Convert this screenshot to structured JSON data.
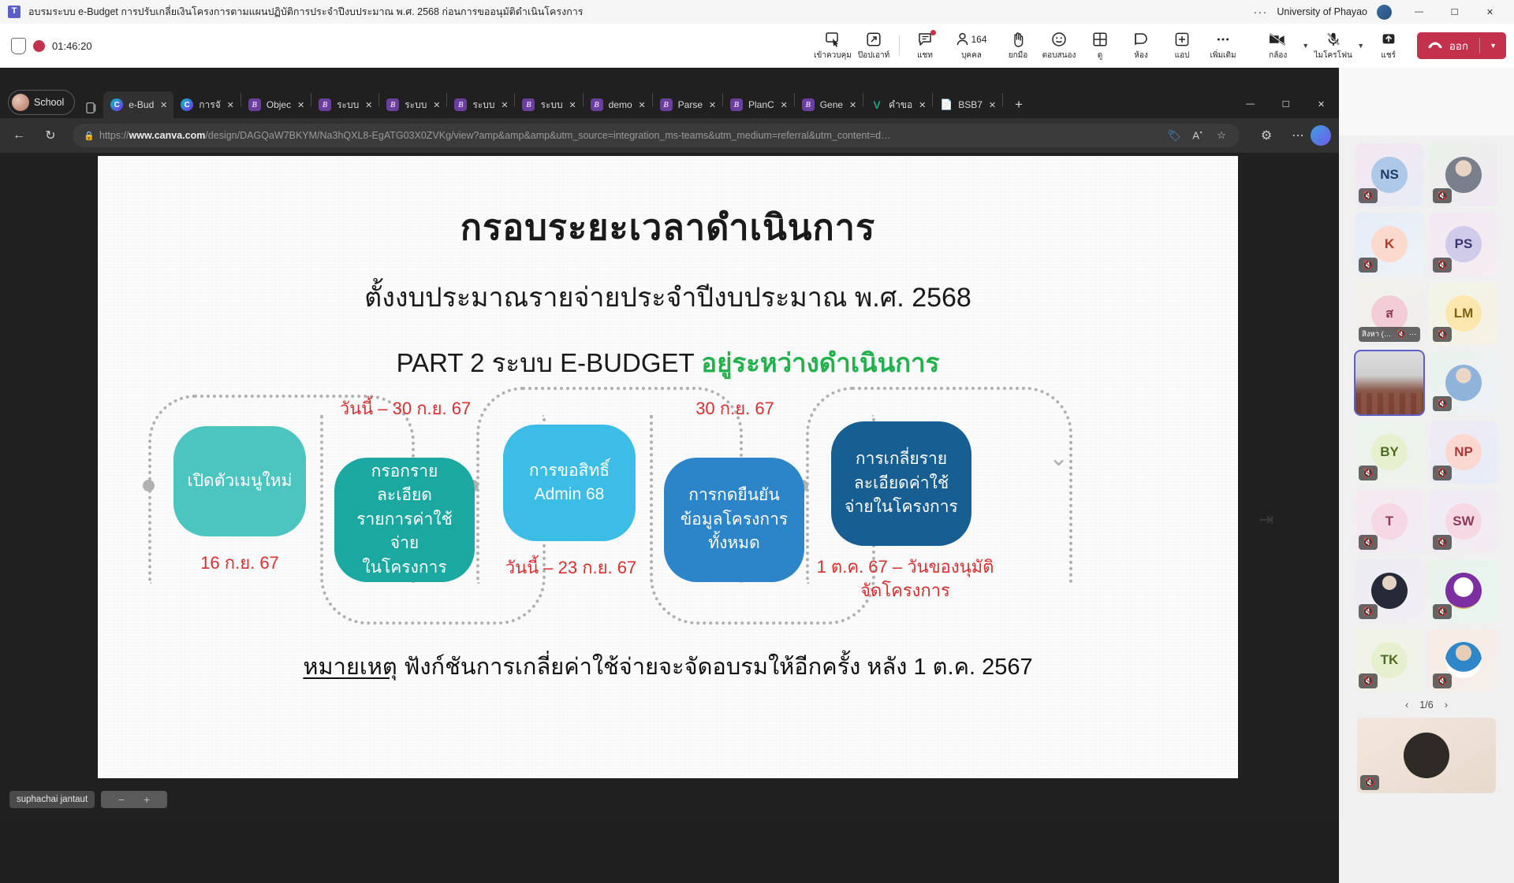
{
  "titlebar": {
    "meeting_title": "อบรมระบบ e-Budget การปรับเกลี่ยเงินโครงการตามแผนปฏิบัติการประจำปีงบประมาณ พ.ศ. 2568 ก่อนการขออนุมัติดำเนินโครงการ",
    "overflow": "···",
    "org": "University of Phayao",
    "minimize": "—",
    "maximize": "☐",
    "close": "✕"
  },
  "meetingbar": {
    "timer": "01:46:20",
    "items": [
      {
        "icon": "take-control-icon",
        "label": "เข้าควบคุม"
      },
      {
        "icon": "pop-out-icon",
        "label": "ป๊อปเอาท์"
      },
      {
        "icon": "chat-icon",
        "label": "แชท",
        "badge": true
      },
      {
        "icon": "people-icon",
        "label": "บุคคล",
        "count": "164"
      },
      {
        "icon": "raise-hand-icon",
        "label": "ยกมือ"
      },
      {
        "icon": "react-icon",
        "label": "ตอบสนอง"
      },
      {
        "icon": "view-icon",
        "label": "ดู"
      },
      {
        "icon": "rooms-icon",
        "label": "ห้อง"
      },
      {
        "icon": "apps-icon",
        "label": "แอป"
      },
      {
        "icon": "more-icon",
        "label": "เพิ่มเติม"
      }
    ],
    "camera": {
      "label": "กล้อง",
      "state": "off"
    },
    "microphone": {
      "label": "ไมโครโฟน",
      "state": "off"
    },
    "share": {
      "label": "แชร์"
    },
    "leave": {
      "label": "ออก"
    }
  },
  "browser": {
    "profile": "School",
    "tabs": [
      {
        "title": "e-Bud",
        "favicon": "canva",
        "active": true
      },
      {
        "title": "การจั",
        "favicon": "canva",
        "active": false
      },
      {
        "title": "Objec",
        "favicon": "purple",
        "active": false
      },
      {
        "title": "ระบบ",
        "favicon": "purple",
        "active": false
      },
      {
        "title": "ระบบ",
        "favicon": "purple",
        "active": false
      },
      {
        "title": "ระบบ",
        "favicon": "purple",
        "active": false
      },
      {
        "title": "ระบบ",
        "favicon": "purple",
        "active": false
      },
      {
        "title": "demo",
        "favicon": "purple",
        "active": false
      },
      {
        "title": "Parse",
        "favicon": "purple",
        "active": false
      },
      {
        "title": "PlanC",
        "favicon": "purple",
        "active": false
      },
      {
        "title": "Gene",
        "favicon": "purple",
        "active": false
      },
      {
        "title": "คำขอ",
        "favicon": "v",
        "active": false
      },
      {
        "title": "BSB7",
        "favicon": "doc",
        "active": false
      }
    ],
    "new_tab": "+",
    "back": "←",
    "reload": "↻",
    "lock_icon": "lock-icon",
    "url_prefix": "https://",
    "url_domain": "www.canva.com",
    "url_rest": "/design/DAGQaW7BKYM/Na3hQXL8-EgATG03X0ZVKg/view?amp&amp&amp&utm_source=integration_ms-teams&utm_medium=referral&utm_content=d…",
    "icons": [
      "tag-icon",
      "read-aloud-icon",
      "favorite-icon",
      "settings-icon",
      "more-icon",
      "copilot-icon"
    ],
    "window_minimize": "—",
    "window_maximize": "☐",
    "window_close": "✕"
  },
  "slide": {
    "title": "กรอบระยะเวลาดำเนินการ",
    "subtitle": "ตั้งงบประมาณรายจ่ายประจำปีงบประมาณ พ.ศ. 2568",
    "part_prefix": "PART 2 ระบบ E-BUDGET",
    "part_highlight": "อยู่ระหว่างดำเนินการ",
    "nodes": [
      {
        "label": "เปิดตัวเมนูใหม่",
        "color": "#4cc5c1",
        "date": "16 ก.ย. 67",
        "date_position": "below"
      },
      {
        "label": "กรอกรายละเอียด\nรายการค่าใช้จ่าย\nในโครงการ",
        "color": "#1aa8a0",
        "date": "วันนี้ – 30 ก.ย. 67",
        "date_position": "above"
      },
      {
        "label": "การขอสิทธิ์\nAdmin 68",
        "color": "#3bbde6",
        "date": "วันนี้ – 23 ก.ย. 67",
        "date_position": "below"
      },
      {
        "label": "การกดยืนยัน\nข้อมูลโครงการ\nทั้งหมด",
        "color": "#2b85c8",
        "date": "30 ก.ย. 67",
        "date_position": "above"
      },
      {
        "label": "การเกลี่ยราย\nละเอียดค่าใช้\nจ่ายในโครงการ",
        "color": "#175e92",
        "date": "1 ต.ค. 67 – วันของนุมัติ\nจัดโครงการ",
        "date_position": "below"
      }
    ],
    "note_label": "หมายเหตุ",
    "note_text": "ฟังก์ชันการเกลี่ยค่าใช้จ่ายจะจัดอบรมให้อีกครั้ง หลัง 1 ต.ค. 2567",
    "next_arrow": "⇥",
    "accent_green": "#22b14c",
    "accent_red": "#d83030"
  },
  "taskbar": {
    "user_pill": "suphachai jantaut",
    "zoom_out": "−",
    "zoom_in": "+"
  },
  "participants": {
    "cells": [
      {
        "initials": "NS",
        "kind": "initials",
        "bg": "#f3e3ec",
        "av": "#adc8e8",
        "fg": "#1f3a63",
        "muted": true
      },
      {
        "initials": "",
        "kind": "photo-man-suit",
        "bg": "#e9f1e7",
        "av": "#d9c4dd",
        "fg": "#333",
        "muted": true
      },
      {
        "initials": "K",
        "kind": "initials",
        "bg": "#e4eaf4",
        "av": "#fbd9cc",
        "fg": "#b03a28",
        "muted": true
      },
      {
        "initials": "PS",
        "kind": "initials",
        "bg": "#f1e6f2",
        "av": "#cfcbe9",
        "fg": "#3a3470",
        "muted": true
      },
      {
        "initials": "ส",
        "kind": "initials-named",
        "bg": "#f1efe7",
        "av": "#f2cdd7",
        "fg": "#8d3a55",
        "muted": true,
        "name": "สิงหา (ไ…",
        "more": "···"
      },
      {
        "initials": "LM",
        "kind": "initials",
        "bg": "#eef2e6",
        "av": "#fbe7ae",
        "fg": "#7d6415",
        "muted": true
      },
      {
        "initials": "",
        "kind": "room-video",
        "bg": "#2a2a2a",
        "av": "",
        "fg": "#fff",
        "muted": false,
        "selected": true
      },
      {
        "initials": "",
        "kind": "photo-man-blue",
        "bg": "#e7f1ec",
        "av": "#cfe0ef",
        "fg": "#333",
        "muted": true
      },
      {
        "initials": "BY",
        "kind": "initials",
        "bg": "#e8f2ee",
        "av": "#e6f0cf",
        "fg": "#4e6b22",
        "muted": true
      },
      {
        "initials": "NP",
        "kind": "initials",
        "bg": "#e9ecf5",
        "av": "#fbd7d2",
        "fg": "#ab3a3a",
        "muted": true
      },
      {
        "initials": "T",
        "kind": "initials",
        "bg": "#f5e9ef",
        "av": "#f6d7e4",
        "fg": "#8d3a55",
        "muted": true
      },
      {
        "initials": "SW",
        "kind": "initials",
        "bg": "#eeeaf4",
        "av": "#f6d7e4",
        "fg": "#8d3a55",
        "muted": true
      },
      {
        "initials": "",
        "kind": "photo-man-dark",
        "bg": "#ecebf2",
        "av": "#dfe3ee",
        "fg": "#333",
        "muted": true
      },
      {
        "initials": "",
        "kind": "logo-crest",
        "bg": "#e6f2ec",
        "av": "#ffffff",
        "fg": "#6b2f9e",
        "muted": true
      },
      {
        "initials": "TK",
        "kind": "initials",
        "bg": "#f1f2e5",
        "av": "#e6f0cf",
        "fg": "#4e6b22",
        "muted": true
      },
      {
        "initials": "",
        "kind": "photo-officer",
        "bg": "#f7ebe5",
        "av": "#2f86c9",
        "fg": "#fff",
        "muted": true
      }
    ],
    "page": "1/6",
    "prev": "‹",
    "next": "›",
    "mic_off_icon": "mic-off-icon"
  }
}
